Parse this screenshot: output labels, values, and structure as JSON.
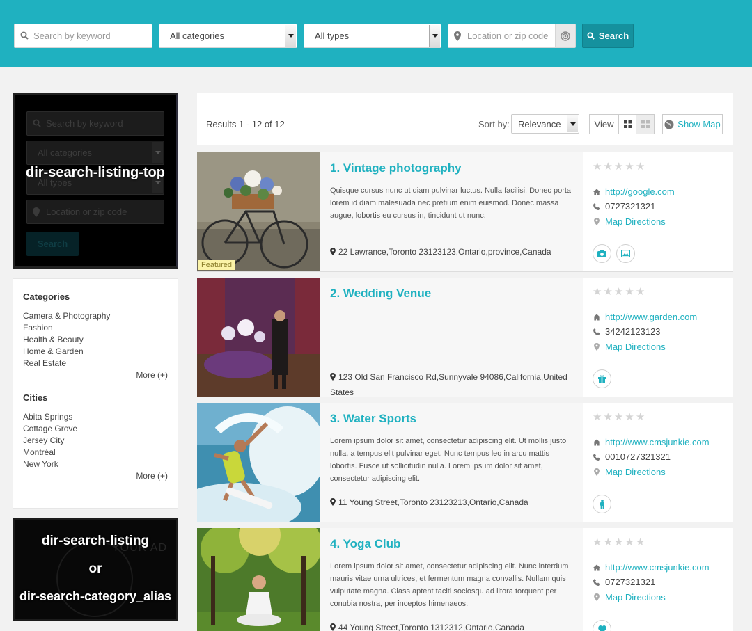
{
  "search_bar": {
    "keyword_placeholder": "Search by keyword",
    "category_value": "All categories",
    "type_value": "All types",
    "location_placeholder": "Location or zip code",
    "search_label": "Search"
  },
  "module_top": {
    "label": "dir-search-listing-top",
    "ghost_keyword": "Search by keyword",
    "ghost_category": "All categories",
    "ghost_type": "All types",
    "ghost_location": "Location or zip code",
    "ghost_button": "Search"
  },
  "filters": {
    "categories_title": "Categories",
    "categories": [
      "Camera & Photography",
      "Fashion",
      "Health & Beauty",
      "Home & Garden",
      "Real Estate"
    ],
    "categories_more": "More (+)",
    "cities_title": "Cities",
    "cities": [
      "Abita Springs",
      "Cottage Grove",
      "Jersey City",
      "Montréal",
      "New York"
    ],
    "cities_more": "More (+)"
  },
  "module_bottom": {
    "line1": "dir-search-listing",
    "line2": "or",
    "line3": "dir-search-category_alias",
    "ghost_text": "YOUR AD"
  },
  "results_header": {
    "count_text": "Results 1 - 12 of 12",
    "sort_label": "Sort by:",
    "sort_value": "Relevance",
    "view_label": "View",
    "show_map_label": "Show Map"
  },
  "listings": [
    {
      "title": "1. Vintage photography",
      "description": "Quisque cursus nunc ut diam pulvinar luctus. Nulla facilisi. Donec porta lorem id diam malesuada nec pretium enim euismod. Donec massa augue, lobortis eu cursus in, tincidunt ut nunc.",
      "address": "22 Lawrance,Toronto 23123123,Ontario,province,Canada",
      "website": "http://google.com",
      "phone": "0727321321",
      "directions": "Map Directions",
      "featured_label": "Featured"
    },
    {
      "title": "2. Wedding Venue",
      "description": "",
      "address": "123 Old San Francisco Rd,Sunnyvale 94086,California,United States",
      "website": "http://www.garden.com",
      "phone": "34242123123",
      "directions": "Map Directions"
    },
    {
      "title": "3. Water Sports",
      "description": "Lorem ipsum dolor sit amet, consectetur adipiscing elit. Ut mollis justo nulla, a tempus elit pulvinar eget. Nunc tempus leo in arcu mattis lobortis. Fusce ut sollicitudin nulla. Lorem ipsum dolor sit amet, consectetur adipiscing elit.",
      "address": "11 Young Street,Toronto 23123213,Ontario,Canada",
      "website": "http://www.cmsjunkie.com",
      "phone": "0010727321321",
      "directions": "Map Directions"
    },
    {
      "title": "4. Yoga Club",
      "description": "Lorem ipsum dolor sit amet, consectetur adipiscing elit. Nunc interdum mauris vitae urna ultrices, et fermentum magna convallis. Nullam quis vulputate magna. Class aptent taciti sociosqu ad litora torquent per conubia nostra, per inceptos himenaeos.",
      "address": "44 Young Street,Toronto 1312312,Ontario,Canada",
      "website": "http://www.cmsjunkie.com",
      "phone": "0727321321",
      "directions": "Map Directions"
    }
  ],
  "colors": {
    "accent": "#1fb1c0",
    "button": "#15919e",
    "featured": "#fbf3a8"
  }
}
